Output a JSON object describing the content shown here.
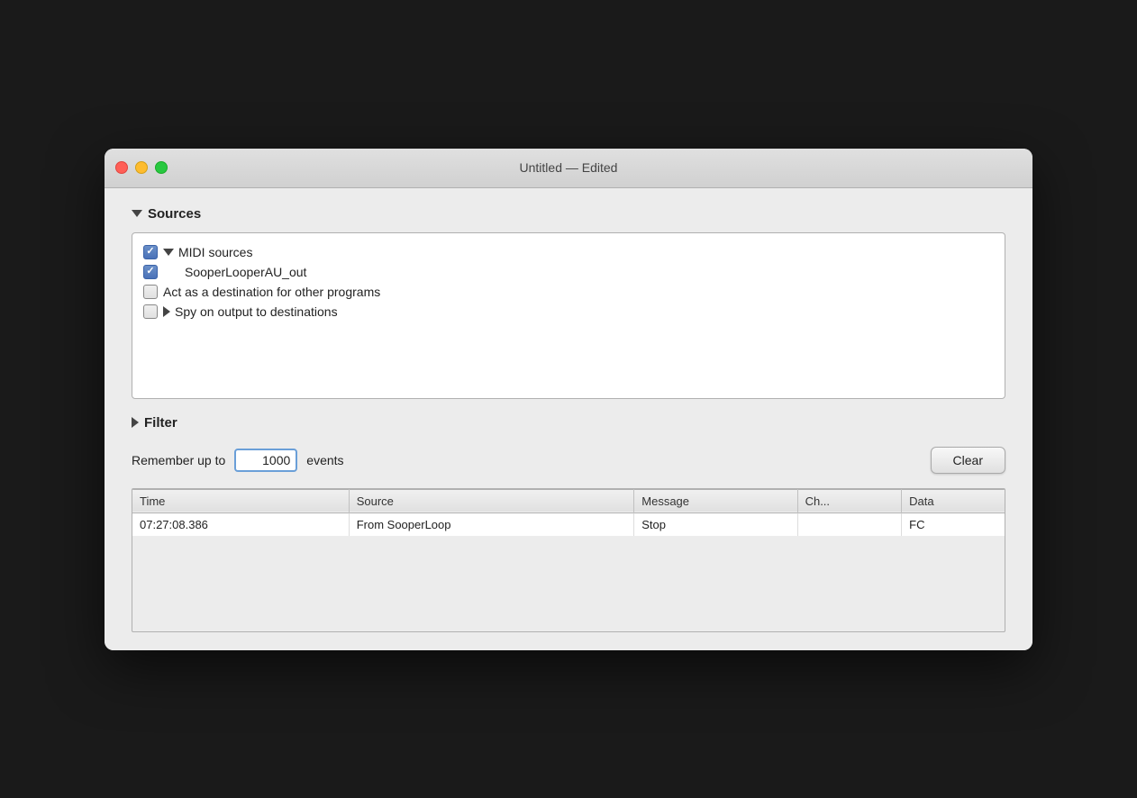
{
  "window": {
    "title": "Untitled — Edited"
  },
  "sources": {
    "section_label": "Sources",
    "midi_sources_label": "MIDI sources",
    "sooper_looper_label": "SooperLooperAU_out",
    "destination_label": "Act as a destination for other programs",
    "spy_label": "Spy on output to destinations",
    "midi_checked": true,
    "sooper_checked": true,
    "destination_checked": false,
    "spy_checked": false
  },
  "filter": {
    "section_label": "Filter"
  },
  "controls": {
    "remember_label": "Remember up to",
    "events_label": "events",
    "events_value": "1000",
    "clear_label": "Clear"
  },
  "table": {
    "columns": [
      "Time",
      "Source",
      "Message",
      "Ch...",
      "Data"
    ],
    "rows": [
      {
        "time": "07:27:08.386",
        "source": "From SooperLoop",
        "message": "Stop",
        "channel": "",
        "data": "FC"
      }
    ]
  }
}
